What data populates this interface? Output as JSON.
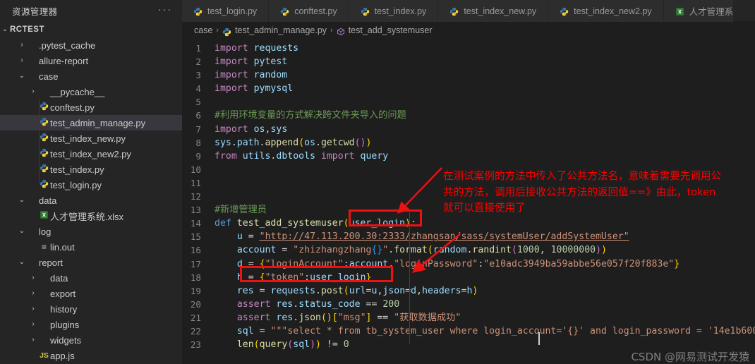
{
  "sidebar": {
    "title": "资源管理器",
    "more_label": "···",
    "root": {
      "label": "RCTEST",
      "chevron": "chevron-down"
    },
    "items": [
      {
        "label": ".pytest_cache",
        "icon": "folder",
        "chevron": "chevron-right",
        "indent": 1,
        "selected": false
      },
      {
        "label": "allure-report",
        "icon": "folder",
        "chevron": "chevron-right",
        "indent": 1,
        "selected": false
      },
      {
        "label": "case",
        "icon": "folder",
        "chevron": "chevron-down",
        "indent": 1,
        "selected": false
      },
      {
        "label": "__pycache__",
        "icon": "folder",
        "chevron": "chevron-right",
        "indent": 2,
        "selected": false
      },
      {
        "label": "conftest.py",
        "icon": "python-icon",
        "chevron": "",
        "indent": 2,
        "selected": false
      },
      {
        "label": "test_admin_manage.py",
        "icon": "python-icon",
        "chevron": "",
        "indent": 2,
        "selected": true
      },
      {
        "label": "test_index_new.py",
        "icon": "python-icon",
        "chevron": "",
        "indent": 2,
        "selected": false
      },
      {
        "label": "test_index_new2.py",
        "icon": "python-icon",
        "chevron": "",
        "indent": 2,
        "selected": false
      },
      {
        "label": "test_index.py",
        "icon": "python-icon",
        "chevron": "",
        "indent": 2,
        "selected": false
      },
      {
        "label": "test_login.py",
        "icon": "python-icon",
        "chevron": "",
        "indent": 2,
        "selected": false
      },
      {
        "label": "data",
        "icon": "folder",
        "chevron": "chevron-down",
        "indent": 1,
        "selected": false
      },
      {
        "label": "人才管理系统.xlsx",
        "icon": "excel-icon",
        "chevron": "",
        "indent": 2,
        "selected": false
      },
      {
        "label": "log",
        "icon": "folder",
        "chevron": "chevron-down",
        "indent": 1,
        "selected": false
      },
      {
        "label": "lin.out",
        "icon": "output-icon",
        "chevron": "",
        "indent": 2,
        "selected": false
      },
      {
        "label": "report",
        "icon": "folder",
        "chevron": "chevron-down",
        "indent": 1,
        "selected": false
      },
      {
        "label": "data",
        "icon": "folder",
        "chevron": "chevron-right",
        "indent": 2,
        "selected": false
      },
      {
        "label": "export",
        "icon": "folder",
        "chevron": "chevron-right",
        "indent": 2,
        "selected": false
      },
      {
        "label": "history",
        "icon": "folder",
        "chevron": "chevron-right",
        "indent": 2,
        "selected": false
      },
      {
        "label": "plugins",
        "icon": "folder",
        "chevron": "chevron-right",
        "indent": 2,
        "selected": false
      },
      {
        "label": "widgets",
        "icon": "folder",
        "chevron": "chevron-right",
        "indent": 2,
        "selected": false
      },
      {
        "label": "app.js",
        "icon": "js-icon",
        "chevron": "",
        "indent": 2,
        "selected": false
      }
    ]
  },
  "tabs": [
    {
      "label": "test_login.py",
      "icon": "python-icon",
      "active": false
    },
    {
      "label": "conftest.py",
      "icon": "python-icon",
      "active": false
    },
    {
      "label": "test_index.py",
      "icon": "python-icon",
      "active": false
    },
    {
      "label": "test_index_new.py",
      "icon": "python-icon",
      "active": false
    },
    {
      "label": "test_index_new2.py",
      "icon": "python-icon",
      "active": false
    },
    {
      "label": "人才管理系",
      "icon": "excel-icon",
      "active": false
    }
  ],
  "breadcrumb": {
    "folder": "case",
    "file": "test_admin_manage.py",
    "symbol": "test_add_systemuser",
    "separator": "›"
  },
  "code": {
    "first_line": 1,
    "last_line": 23,
    "lines": [
      "import requests",
      "import pytest",
      "import random",
      "import pymysql",
      "",
      "#利用环境变量的方式解决跨文件夹导入的问题",
      "import os,sys",
      "sys.path.append(os.getcwd())",
      "from utils.dbtools import query",
      "",
      "",
      "",
      "#新增管理员",
      "def test_add_systemuser(user_login):",
      "    u = \"http://47.113.200.30:2333/zhangsan/sass/systemUser/addSystemUser\"",
      "    account = \"zhizhangzhang{}\".format(random.randint(1000, 10000000))",
      "    d = {\"loginAccount\":account,\"loginPassword\":\"e10adc3949ba59abbe56e057f20f883e\"}",
      "    h = {\"token\":user_login}",
      "    res = requests.post(url=u,json=d,headers=h)",
      "    assert res.status_code == 200",
      "    assert res.json()[\"msg\"] == \"获取数据成功\"",
      "    sql = \"\"\"select * from tb_system_user where login_account='{}' and login_password = '14e1b600",
      "    len(query(sql)) != 0"
    ]
  },
  "annotation": {
    "color": "#fe0000",
    "text_line1": "在测试案例的方法中传入了公共方法名，意味着需要先调用公",
    "text_line2": "共的方法，调用后接收公共方法的返回值==》由此，token",
    "text_line3": "就可以直接使用了",
    "box1_target": "(user_login):",
    "box2_target": "h = {\"token\":user_login}"
  },
  "watermark": {
    "text": "CSDN @网易测试开发猿"
  },
  "colors": {
    "editor_bg": "#1e1e1e",
    "sidebar_bg": "#252526",
    "tab_bg": "#2d2d2d",
    "selection": "#37373d",
    "annotation_red": "#fe0000",
    "comment_green": "#6a9955",
    "string_orange": "#ce9178",
    "keyword_purple": "#c586c0"
  }
}
